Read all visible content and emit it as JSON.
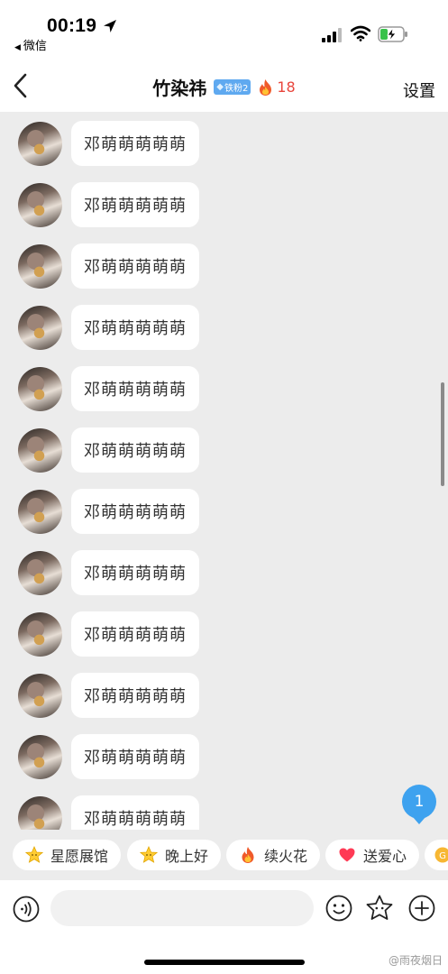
{
  "status_bar": {
    "time": "00:19",
    "back_app": "微信"
  },
  "header": {
    "title": "竹染祎",
    "fan_badge": "铁粉2",
    "fire_count": "18",
    "settings_label": "设置"
  },
  "messages": [
    {
      "text": "邓萌萌萌萌萌"
    },
    {
      "text": "邓萌萌萌萌萌"
    },
    {
      "text": "邓萌萌萌萌萌"
    },
    {
      "text": "邓萌萌萌萌萌"
    },
    {
      "text": "邓萌萌萌萌萌"
    },
    {
      "text": "邓萌萌萌萌萌"
    },
    {
      "text": "邓萌萌萌萌萌"
    },
    {
      "text": "邓萌萌萌萌萌"
    },
    {
      "text": "邓萌萌萌萌萌"
    },
    {
      "text": "邓萌萌萌萌萌"
    },
    {
      "text": "邓萌萌萌萌萌"
    },
    {
      "text": "邓萌萌萌萌萌"
    }
  ],
  "unread_count": "1",
  "quick_replies": [
    {
      "label": "星愿展馆",
      "icon": "star-face-icon"
    },
    {
      "label": "晚上好",
      "icon": "star-face-icon"
    },
    {
      "label": "续火花",
      "icon": "fire-icon"
    },
    {
      "label": "送爱心",
      "icon": "heart-icon"
    },
    {
      "label": "",
      "icon": "gift-icon"
    }
  ],
  "input_bar": {
    "placeholder": ""
  },
  "watermark": "@雨夜烟日",
  "colors": {
    "accent_blue": "#3ea2ef",
    "fire_red": "#e8453c",
    "chat_bg": "#ececec"
  }
}
